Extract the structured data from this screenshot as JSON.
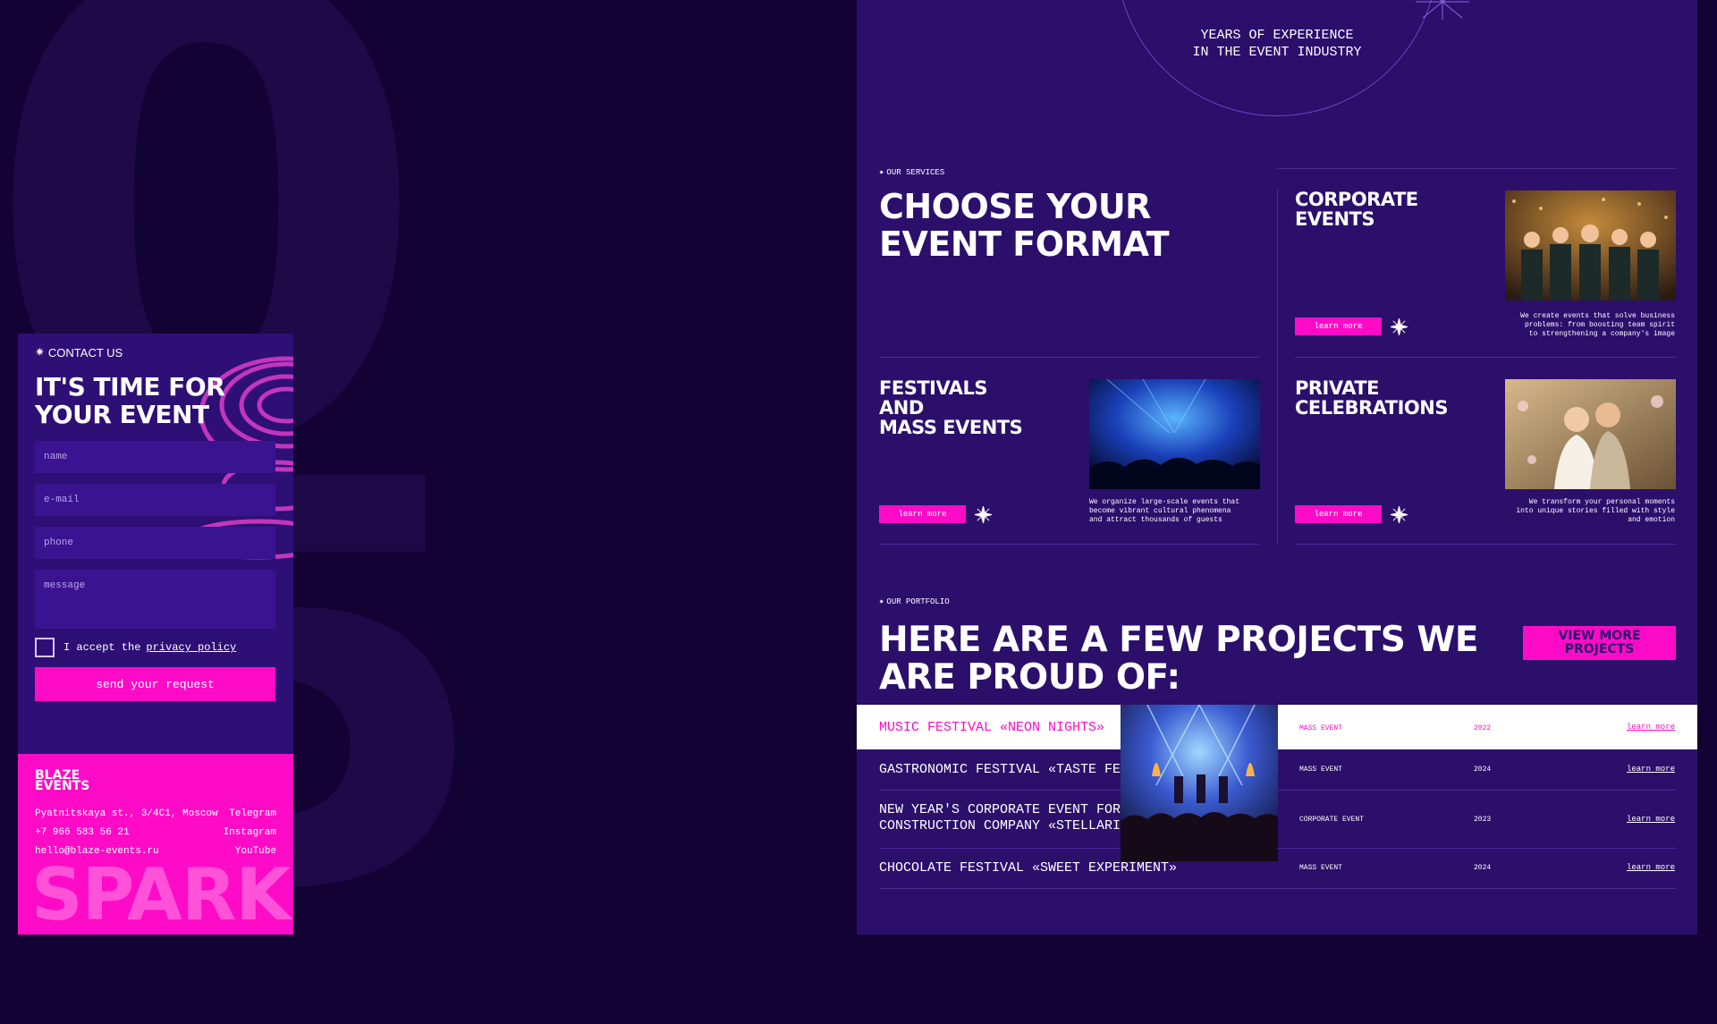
{
  "background_digits": [
    "0",
    "5"
  ],
  "contact": {
    "eyebrow": "CONTACT US",
    "title_line1": "IT'S TIME FOR",
    "title_line2": "YOUR EVENT",
    "placeholders": {
      "name": "name",
      "email": "e-mail",
      "phone": "phone",
      "message": "message"
    },
    "consent_prefix": "I accept the",
    "consent_link": "privacy policy",
    "submit_label": "send your request"
  },
  "footer": {
    "logo_line1": "BLAZE",
    "logo_line2": "EVENTS",
    "address": "Pyatnitskaya st., 3/4C1, Moscow",
    "phone": "+7 966 583 56 21",
    "email": "hello@blaze-events.ru",
    "social": [
      "Telegram",
      "Instagram",
      "YouTube"
    ],
    "big_word": "SPARK"
  },
  "experience": {
    "line1": "YEARS OF EXPERIENCE",
    "line2": "IN THE EVENT INDUSTRY"
  },
  "services": {
    "eyebrow": "OUR SERVICES",
    "title_line1": "CHOOSE YOUR",
    "title_line2": "EVENT FORMAT",
    "items": [
      {
        "title_line1": "CORPORATE",
        "title_line2": "EVENTS",
        "title_line3": "",
        "button": "learn more",
        "desc": "We create events that solve business problems: from boosting team spirit to strengthening a company's image"
      },
      {
        "title_line1": "FESTIVALS",
        "title_line2": "AND",
        "title_line3": "MASS EVENTS",
        "button": "learn more",
        "desc": "We organize large-scale events that become vibrant cultural phenomena and attract thousands of guests"
      },
      {
        "title_line1": "PRIVATE",
        "title_line2": "CELEBRATIONS",
        "title_line3": "",
        "button": "learn more",
        "desc": "We transform your personal moments into unique stories filled with style and emotion"
      }
    ]
  },
  "portfolio": {
    "eyebrow": "OUR PORTFOLIO",
    "title": "HERE ARE A FEW PROJECTS WE ARE PROUD OF:",
    "view_more_line1": "VIEW MORE",
    "view_more_line2": "PROJECTS",
    "rows": [
      {
        "name": "MUSIC FESTIVAL «NEON NIGHTS»",
        "type": "MASS EVENT",
        "year": "2022",
        "link": "learn more"
      },
      {
        "name": "GASTRONOMIC FESTIVAL «TASTE FEST»",
        "type": "MASS EVENT",
        "year": "2024",
        "link": "learn more"
      },
      {
        "name_line1": "NEW YEAR'S CORPORATE EVENT FOR A",
        "name_line2": "CONSTRUCTION  COMPANY «STELLARIS»",
        "type": "CORPORATE EVENT",
        "year": "2023",
        "link": "learn more"
      },
      {
        "name": "CHOCOLATE FESTIVAL «SWEET EXPERIMENT»",
        "type": "MASS EVENT",
        "year": "2024",
        "link": "learn more"
      }
    ]
  },
  "colors": {
    "bg": "#130234",
    "panel": "#2b0f6b",
    "accent": "#fd0bc7"
  }
}
